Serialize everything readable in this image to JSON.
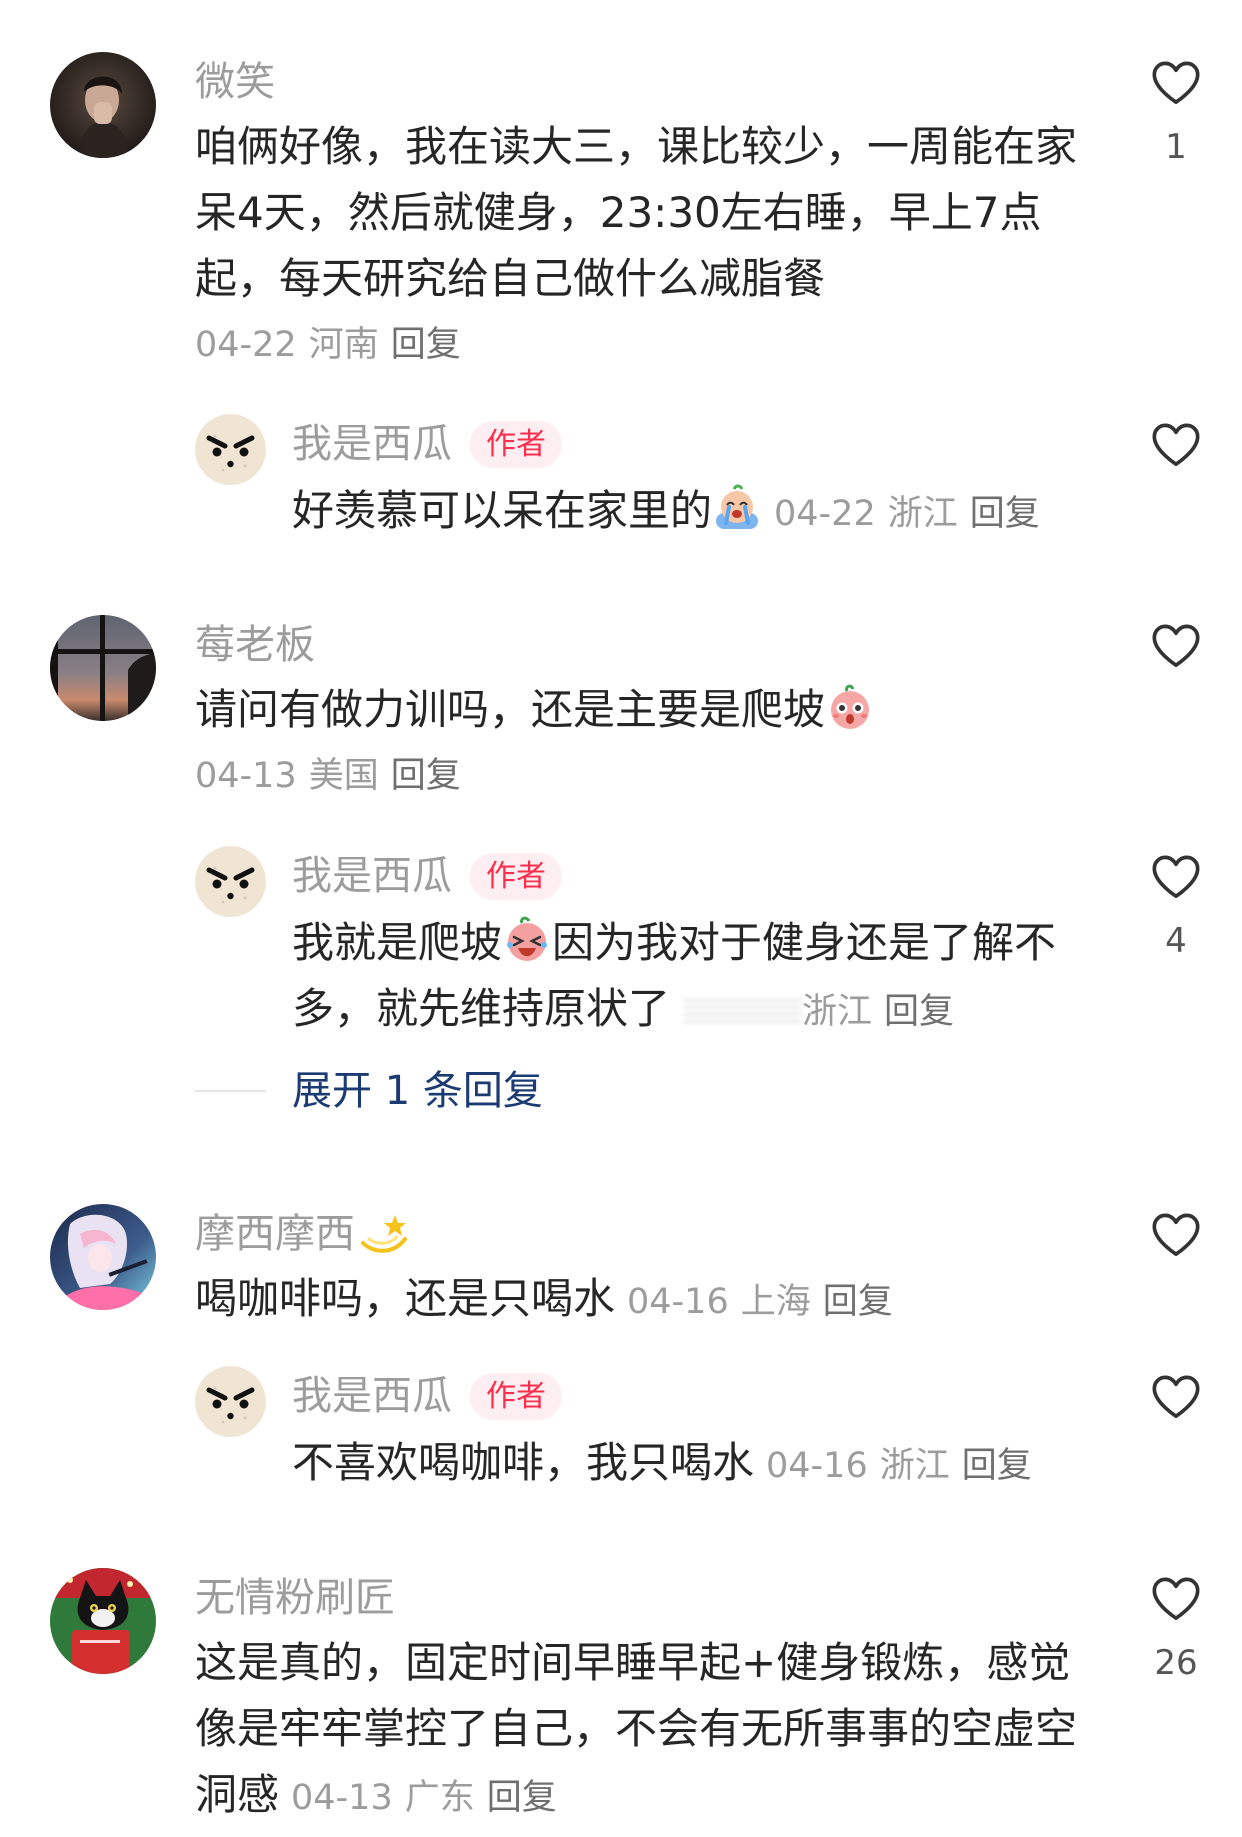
{
  "colors": {
    "name": "#9c9c9c",
    "text": "#262626",
    "meta": "#9c9c9c",
    "author_badge_bg": "#fdeef1",
    "author_badge_text": "#ff2e4d",
    "expand_link": "#1d3b73"
  },
  "icons": {
    "like": "heart-outline-icon",
    "reply1_sticker": "crying-sticker-icon",
    "comment2_sticker": "shocked-sticker-icon",
    "reply2_sticker": "laughing-sticker-icon",
    "comment3_name_sticker": "dizzy-star-icon"
  },
  "comment_1": {
    "name": "微笑",
    "lines": [
      "咱俩好像，我在读大三，课比较少，一周能在家",
      "呆4天，然后就健身，23:30左右睡，早上7点",
      "起，每天研究给自己做什么减脂餐"
    ],
    "date": "04-22",
    "location": "河南",
    "reply": "回复",
    "likes": "1"
  },
  "reply_1": {
    "name": "我是西瓜",
    "badge": "作者",
    "text": "好羡慕可以呆在家里的",
    "date": "04-22",
    "location": "浙江",
    "reply": "回复"
  },
  "comment_2": {
    "name": "莓老板",
    "text": "请问有做力训吗，还是主要是爬坡",
    "date": "04-13",
    "location": "美国",
    "reply": "回复"
  },
  "reply_2": {
    "name": "我是西瓜",
    "badge": "作者",
    "line1_before": "我就是爬坡",
    "line1_after": "因为我对于健身还是了解不",
    "line2": "多，就先维持原状了",
    "location": "浙江",
    "reply": "回复",
    "likes": "4"
  },
  "expand_replies": "展开 1 条回复",
  "comment_3": {
    "name": "摩西摩西",
    "text": "喝咖啡吗，还是只喝水",
    "date": "04-16",
    "location": "上海",
    "reply": "回复"
  },
  "reply_3": {
    "name": "我是西瓜",
    "badge": "作者",
    "text": "不喜欢喝咖啡，我只喝水",
    "date": "04-16",
    "location": "浙江",
    "reply": "回复"
  },
  "comment_4": {
    "name": "无情粉刷匠",
    "lines": [
      "这是真的，固定时间早睡早起+健身锻炼，感觉",
      "像是牢牢掌控了自己，不会有无所事事的空虚空"
    ],
    "last_line": "洞感",
    "date": "04-13",
    "location": "广东",
    "reply": "回复",
    "likes": "26"
  }
}
